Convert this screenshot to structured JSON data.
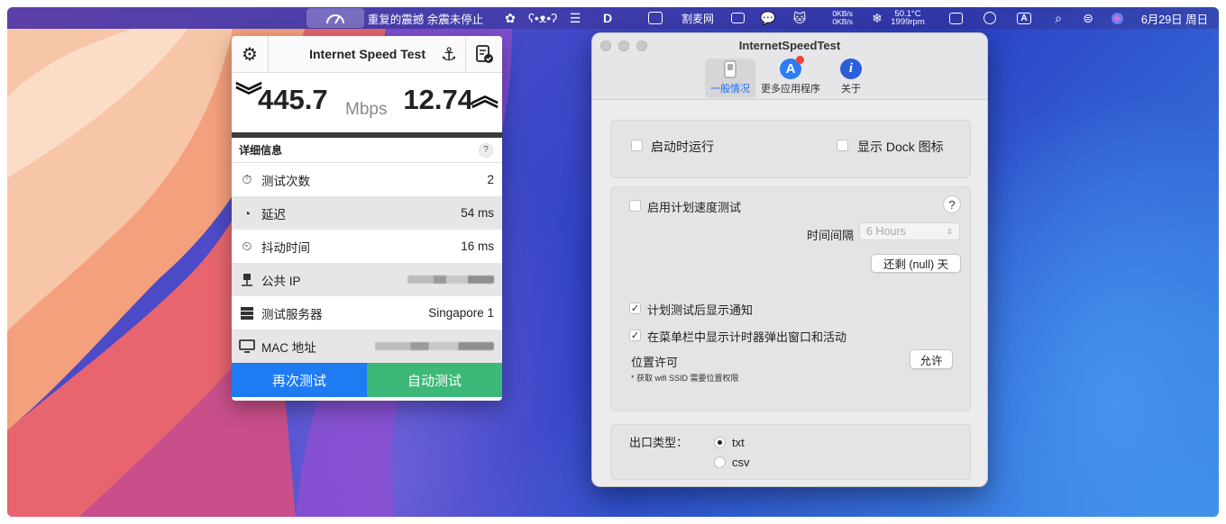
{
  "menubar": {
    "speed_icon": "speedometer-icon",
    "ticker_text": "重复的震撼 余震未停止",
    "app_label": "割麦网",
    "net_up": "0KB/s",
    "net_down": "0KB/s",
    "cpu_temp": "50.1°C",
    "fan_rpm": "1999rpm",
    "input_method": "A",
    "datetime": "6月29日 周日"
  },
  "speedtest": {
    "title": "Internet Speed Test",
    "download": "445.7",
    "unit": "Mbps",
    "upload": "12.74",
    "details_label": "详细信息",
    "help": "?",
    "rows": [
      {
        "label": "测试次数",
        "value": "2"
      },
      {
        "label": "延迟",
        "value": "54 ms"
      },
      {
        "label": "抖动时间",
        "value": "16 ms"
      },
      {
        "label": "公共 IP",
        "value": ""
      },
      {
        "label": "测试服务器",
        "value": "Singapore 1"
      },
      {
        "label": "MAC 地址",
        "value": ""
      }
    ],
    "retest_label": "再次测试",
    "autotest_label": "自动测试"
  },
  "prefs": {
    "window_title": "InternetSpeedTest",
    "toolbar": [
      {
        "label": "一般情况",
        "active": true
      },
      {
        "label": "更多应用程序",
        "active": false
      },
      {
        "label": "关于",
        "active": false
      }
    ],
    "launch_at_login": "启动时运行",
    "show_dock_icon": "显示 Dock 图标",
    "enable_schedule": "启用计划速度测试",
    "help": "?",
    "interval_label": "时间间隔",
    "interval_value": "6 Hours",
    "remaining_label": "还剩 (null) 天",
    "notify_after_test": "计划测试后显示通知",
    "show_timer_popup": "在菜单栏中显示计时器弹出窗口和活动",
    "location_label": "位置许可",
    "location_note": "* 获取 wifi SSID 需要位置权限",
    "allow_label": "允许",
    "export_label": "出口类型：",
    "export_options": [
      "txt",
      "csv"
    ],
    "export_selected": "txt"
  }
}
